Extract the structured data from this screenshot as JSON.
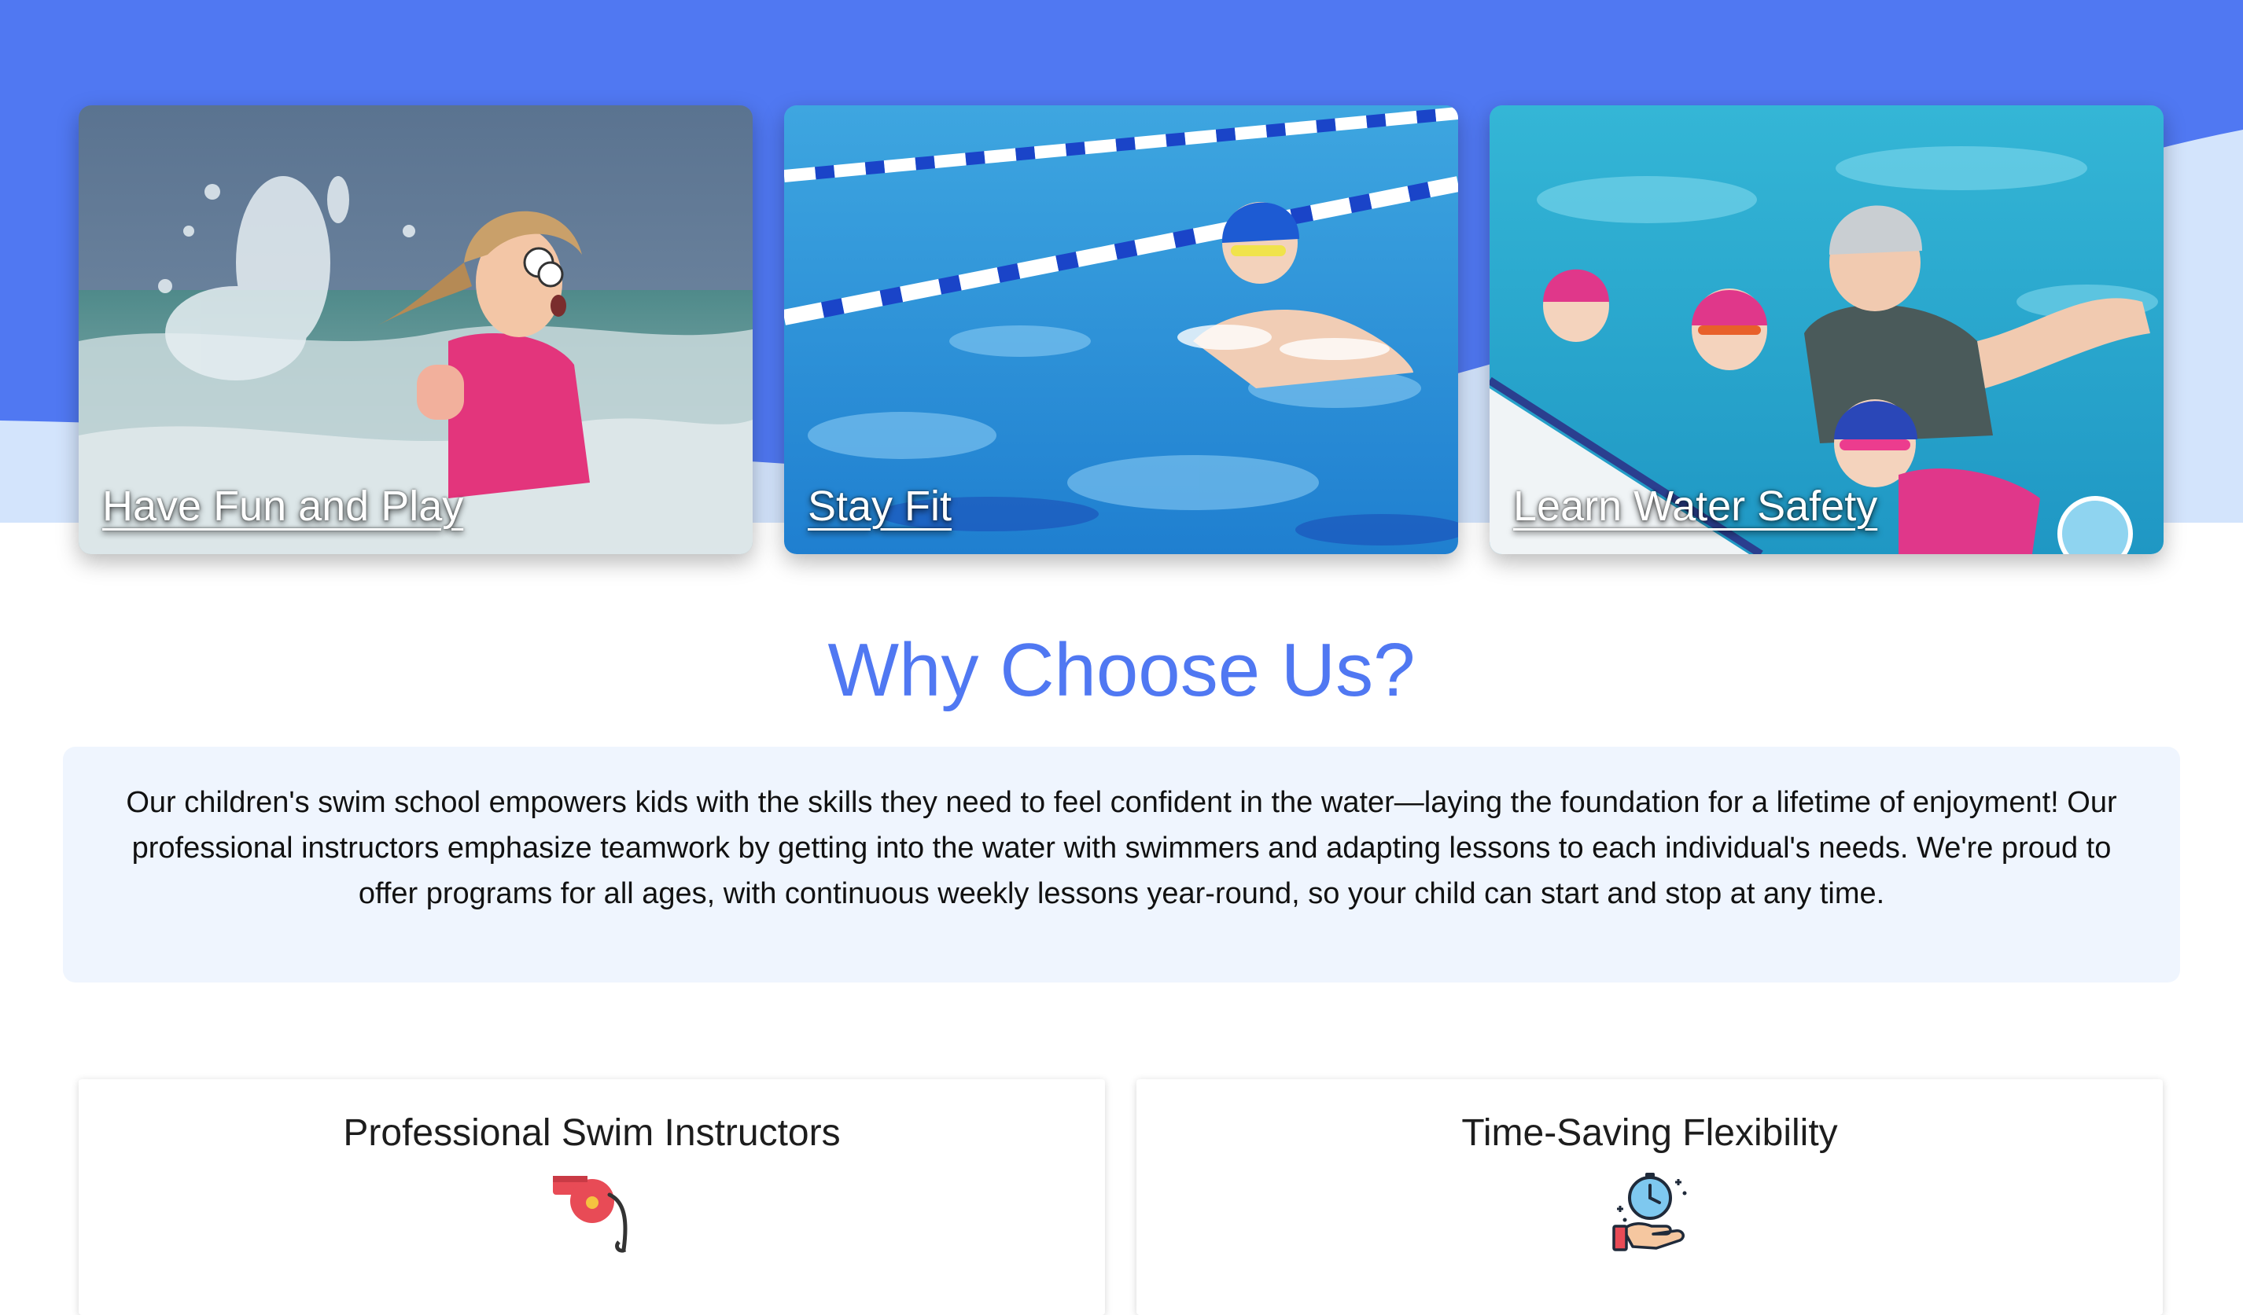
{
  "colors": {
    "brand_blue": "#5078f2",
    "wave_light": "#d3e4fc",
    "intro_bg": "#eff5fe"
  },
  "feature_cards": [
    {
      "title": "Have Fun and Play",
      "image": "girl splashing in ocean waves"
    },
    {
      "title": "Stay Fit",
      "image": "boy swimming in pool lane"
    },
    {
      "title": "Learn Water Safety",
      "image": "instructor with children in pool"
    }
  ],
  "why": {
    "heading": "Why Choose Us?",
    "paragraph": "Our children's swim school empowers kids with the skills they need to feel confident in the water—laying the foundation for a lifetime of enjoyment! Our professional instructors emphasize teamwork by getting into the water with swimmers and adapting lessons to each individual's needs. We're proud to offer programs for all ages, with continuous weekly lessons year-round, so your child can start and stop at any time."
  },
  "benefits": [
    {
      "title": "Professional Swim Instructors",
      "icon": "whistle-icon"
    },
    {
      "title": "Time-Saving Flexibility",
      "icon": "clock-in-hand-icon"
    }
  ]
}
